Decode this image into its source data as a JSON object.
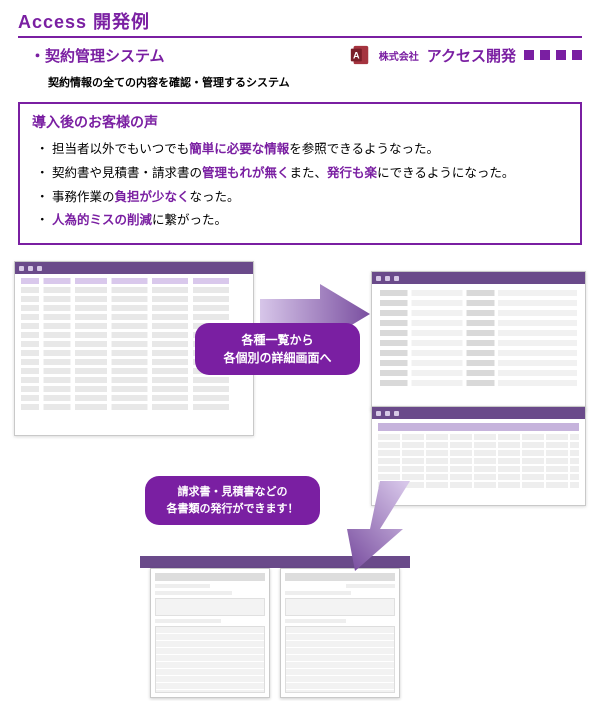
{
  "header": {
    "title": "Access 開発例",
    "subtitle": "・契約管理システム",
    "brand_prefix": "株式会社",
    "brand_name": "アクセス開発",
    "description": "契約情報の全ての内容を確認・管理するシステム"
  },
  "testimonial": {
    "heading": "導入後のお客様の声",
    "items": [
      {
        "pre": "担当者以外でもいつでも",
        "em": "簡単に必要な情報",
        "post": "を参照できるようなった。"
      },
      {
        "pre": "契約書や見積書・請求書の",
        "em": "管理もれが無く",
        "mid": "また、",
        "em2": "発行も楽",
        "post": "にできるようになった。"
      },
      {
        "pre": "事務作業の",
        "em": "負担が少なく",
        "post": "なった。"
      },
      {
        "pre": "",
        "em": "人為的ミスの削減",
        "post": "に繋がった。"
      }
    ]
  },
  "flow": {
    "bubble1_line1": "各種一覧から",
    "bubble1_line2": "各個別の詳細画面へ",
    "bubble2_line1": "請求書・見積書などの",
    "bubble2_line2": "各書類の発行ができます！"
  }
}
